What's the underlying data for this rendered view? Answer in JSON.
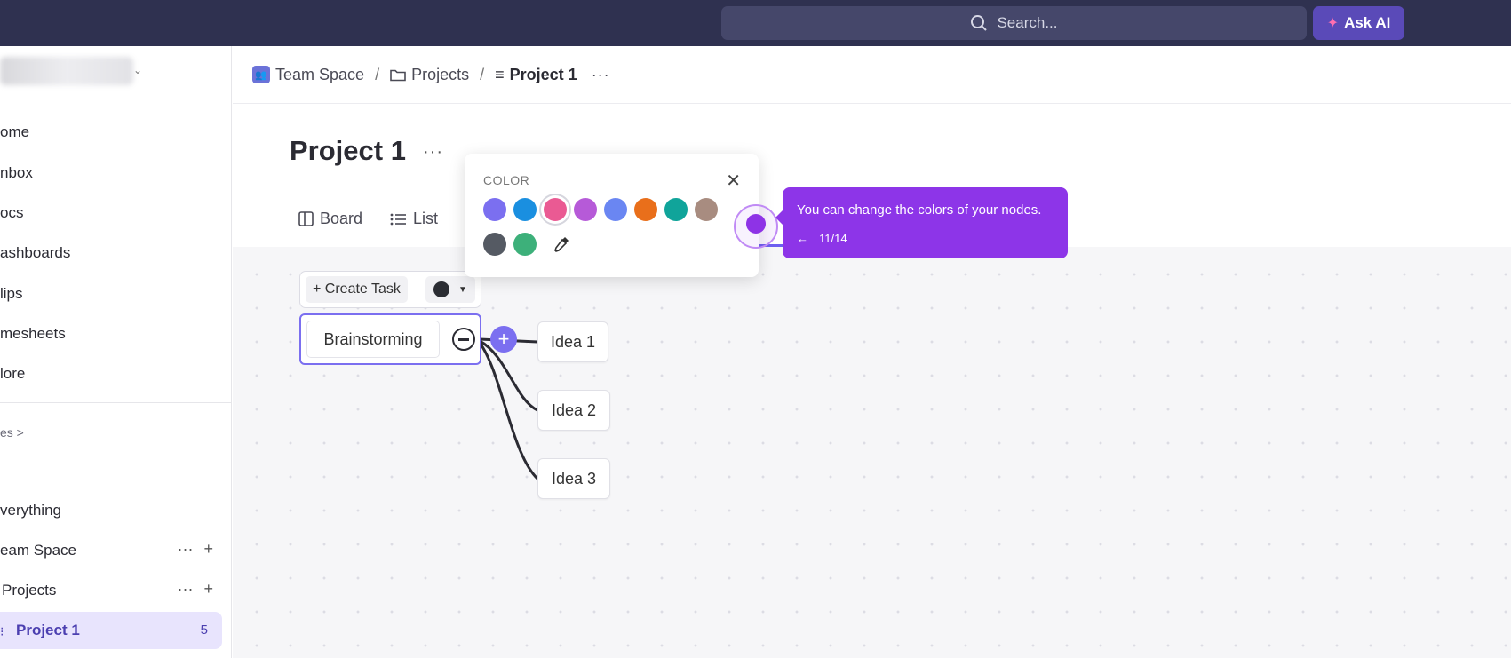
{
  "topbar": {
    "search_placeholder": "Search...",
    "ask_ai": "Ask AI"
  },
  "sidebar": {
    "nav": [
      "ome",
      "nbox",
      "ocs",
      "ashboards",
      "lips",
      "mesheets",
      "lore"
    ],
    "section_label": "es >",
    "tree": [
      {
        "label": "verything"
      },
      {
        "label": "eam Space"
      },
      {
        "label": "Projects"
      }
    ],
    "active": {
      "label": "Project 1",
      "count": "5"
    }
  },
  "breadcrumb": {
    "space": "Team Space",
    "folder": "Projects",
    "current": "Project 1",
    "more": "···"
  },
  "page": {
    "title": "Project 1",
    "more": "···"
  },
  "tabs": [
    {
      "label": "Board"
    },
    {
      "label": "List"
    }
  ],
  "toolbar": {
    "create_task": "+ Create Task"
  },
  "mindmap": {
    "root": "Brainstorming",
    "ideas": [
      "Idea 1",
      "Idea 2",
      "Idea 3"
    ]
  },
  "color_popup": {
    "header": "COLOR",
    "close": "✕",
    "swatches": [
      "#7b6ff0",
      "#1a8fe0",
      "#ea5a93",
      "#b65ad8",
      "#6a86f2",
      "#e96f1b",
      "#10a49a",
      "#a88c80",
      "#555a63",
      "#3db07a"
    ],
    "selected_index": 2
  },
  "tooltip": {
    "message": "You can change the colors of your nodes.",
    "back": "←",
    "step": "11/14"
  }
}
